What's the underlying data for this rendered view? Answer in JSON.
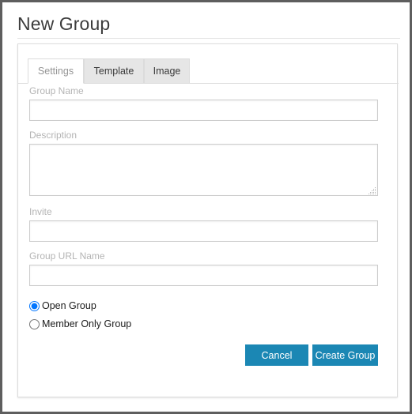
{
  "page": {
    "title": "New Group"
  },
  "tabs": [
    {
      "label": "Settings",
      "active": true
    },
    {
      "label": "Template",
      "active": false
    },
    {
      "label": "Image",
      "active": false
    }
  ],
  "form": {
    "fields": [
      {
        "label": "Group Name",
        "value": "",
        "placeholder": "",
        "type": "text"
      },
      {
        "label": "Description",
        "value": "",
        "placeholder": "",
        "type": "textarea"
      },
      {
        "label": "Invite",
        "value": "",
        "placeholder": "",
        "type": "text"
      },
      {
        "label": "Group URL Name",
        "value": "",
        "placeholder": "",
        "type": "text"
      }
    ],
    "visibility": {
      "group_name": "visibility-group",
      "options": [
        {
          "label": "Open Group",
          "selected": true
        },
        {
          "label": "Member Only Group",
          "selected": false
        }
      ]
    }
  },
  "actions": {
    "cancel_label": "Cancel",
    "create_label": "Create Group"
  },
  "colors": {
    "button_blue": "#1b87b4",
    "label_gray": "#b4b4b4",
    "frame_gray": "#5e5e5e",
    "tab_inactive_bg": "#e6e6e6",
    "border_gray": "#dcdcdc"
  }
}
